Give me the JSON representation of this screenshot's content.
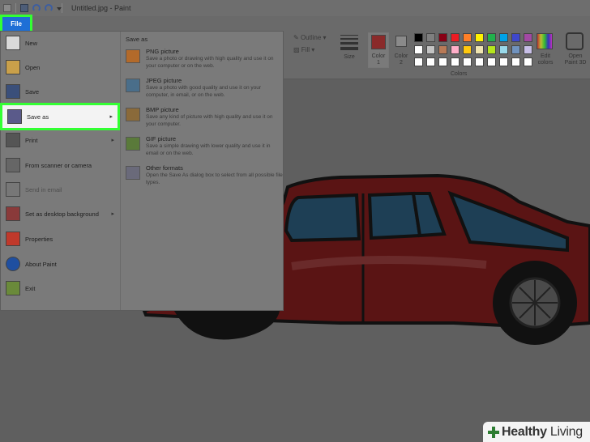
{
  "window": {
    "title": "Untitled.jpg - Paint"
  },
  "ribbon": {
    "file_tab": "File",
    "outline_label": "Outline",
    "fill_label": "Fill",
    "size_label": "Size",
    "color1_label": "Color\n1",
    "color2_label": "Color\n2",
    "colors_group_label": "Colors",
    "edit_colors_label": "Edit\ncolors",
    "open_3d_label": "Open\nPaint 3D",
    "palette": [
      "#000000",
      "#7f7f7f",
      "#880015",
      "#ed1c24",
      "#ff7f27",
      "#fff200",
      "#22b14c",
      "#00a2e8",
      "#3f48cc",
      "#a349a4",
      "#ffffff",
      "#c3c3c3",
      "#b97a57",
      "#ffaec9",
      "#ffc90e",
      "#efe4b0",
      "#b5e61d",
      "#99d9ea",
      "#7092be",
      "#c8bfe7",
      "#ffffff",
      "#ffffff",
      "#ffffff",
      "#ffffff",
      "#ffffff",
      "#ffffff",
      "#ffffff",
      "#ffffff",
      "#ffffff",
      "#ffffff"
    ]
  },
  "file_menu": {
    "items": [
      {
        "label": "New",
        "icon": "new-file-icon",
        "arrow": false
      },
      {
        "label": "Open",
        "icon": "open-folder-icon",
        "arrow": false
      },
      {
        "label": "Save",
        "icon": "save-disk-icon",
        "arrow": false
      },
      {
        "label": "Save as",
        "icon": "save-as-icon",
        "arrow": true
      },
      {
        "label": "Print",
        "icon": "printer-icon",
        "arrow": true
      },
      {
        "label": "From scanner or camera",
        "icon": "scanner-icon",
        "arrow": false
      },
      {
        "label": "Send in email",
        "icon": "email-icon",
        "arrow": false
      },
      {
        "label": "Set as desktop background",
        "icon": "desktop-icon",
        "arrow": true
      },
      {
        "label": "Properties",
        "icon": "checkmark-icon",
        "arrow": false
      },
      {
        "label": "About Paint",
        "icon": "info-icon",
        "arrow": false
      },
      {
        "label": "Exit",
        "icon": "exit-icon",
        "arrow": false
      }
    ],
    "save_as_heading": "Save as",
    "save_as_options": [
      {
        "title": "PNG picture",
        "desc": "Save a photo or drawing with high quality and use it on your computer or on the web."
      },
      {
        "title": "JPEG picture",
        "desc": "Save a photo with good quality and use it on your computer, in email, or on the web."
      },
      {
        "title": "BMP picture",
        "desc": "Save any kind of picture with high quality and use it on your computer."
      },
      {
        "title": "GIF picture",
        "desc": "Save a simple drawing with lower quality and use it in email or on the web."
      },
      {
        "title": "Other formats",
        "desc": "Open the Save As dialog box to select from all possible file types."
      }
    ]
  },
  "watermark": {
    "brand_bold": "Healthy",
    "brand_light": " Living"
  }
}
